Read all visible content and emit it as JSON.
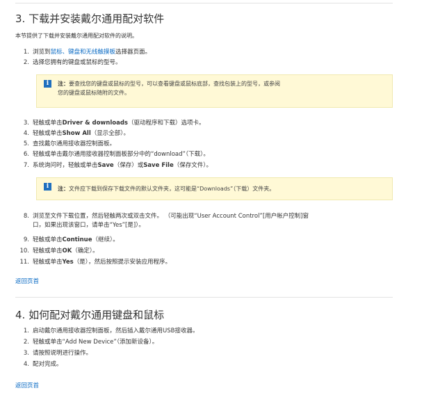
{
  "section3": {
    "title": "3. 下载并安装戴尔通用配对软件",
    "intro": "本节提供了下载并安装戴尔通用配对软件的说明。",
    "step1": {
      "num": "1.",
      "pre": "浏览到",
      "link": "鼠标、键盘和无线触摸板",
      "post": "选择器页面。"
    },
    "step2": {
      "num": "2.",
      "text": "选择您拥有的键盘或鼠标的型号。"
    },
    "note1": {
      "label": "注：",
      "line1": "要查找您的键盘或鼠标的型号，可以查看键盘或鼠标底部，查找包装上的型号，或参阅",
      "line2": "您的键盘或鼠标随附的文件。"
    },
    "step3": {
      "num": "3.",
      "pre": "轻触或单击",
      "bold": "Driver & downloads",
      "post": "（驱动程序和下载）选项卡。"
    },
    "step4": {
      "num": "4.",
      "pre": "轻触或单击",
      "bold": "Show All",
      "post": "（显示全部）。"
    },
    "step5": {
      "num": "5.",
      "text": "查找戴尔通用接收器控制面板。"
    },
    "step6": {
      "num": "6.",
      "text": "轻触或单击戴尔通用接收器控制面板部分中的“download”（下载）。"
    },
    "step7": {
      "num": "7.",
      "pre": "系统询问时，轻触或单击",
      "bold1": "Save",
      "mid": "（保存）或",
      "bold2": "Save File",
      "post": "（保存文件）。"
    },
    "note2": {
      "label": "注：",
      "text": "文件应下载到保存下载文件的默认文件夹，这可能是“Downloads”（下载）文件夹。"
    },
    "step8": {
      "num": "8.",
      "line1": "浏览至文件下载位置，然后轻触两次或双击文件。  （可能出现“User Account Control”[用户帐户控制]窗",
      "line2": "口，如果出现该窗口，请单击“Yes”[是]）。"
    },
    "step9": {
      "num": "9.",
      "pre": "轻触或单击",
      "bold": "Continue",
      "post": "（继续）。"
    },
    "step10": {
      "num": "10.",
      "pre": "轻触或单击",
      "bold": "OK",
      "post": "（确定）。"
    },
    "step11": {
      "num": "11.",
      "pre": "轻触或单击",
      "bold": "Yes",
      "post": "（是），然后按照提示安装应用程序。"
    },
    "back": "返回页首"
  },
  "section4": {
    "title": "4. 如何配对戴尔通用键盘和鼠标",
    "step1": {
      "num": "1.",
      "text": "启动戴尔通用接收器控制面板，然后插入戴尔通用USB接收器。"
    },
    "step2": {
      "num": "2.",
      "text": "轻触或单击“Add New Device”（添加新设备）。"
    },
    "step3": {
      "num": "3.",
      "text": "请按照说明进行操作。"
    },
    "step4": {
      "num": "4.",
      "text": "配对完成。"
    },
    "back": "返回页首"
  },
  "colors": {
    "link": "#0b6bc4",
    "note_bg": "#fff9d6",
    "note_icon": "#1f6fbe"
  },
  "icons": {
    "note": "info-icon"
  }
}
